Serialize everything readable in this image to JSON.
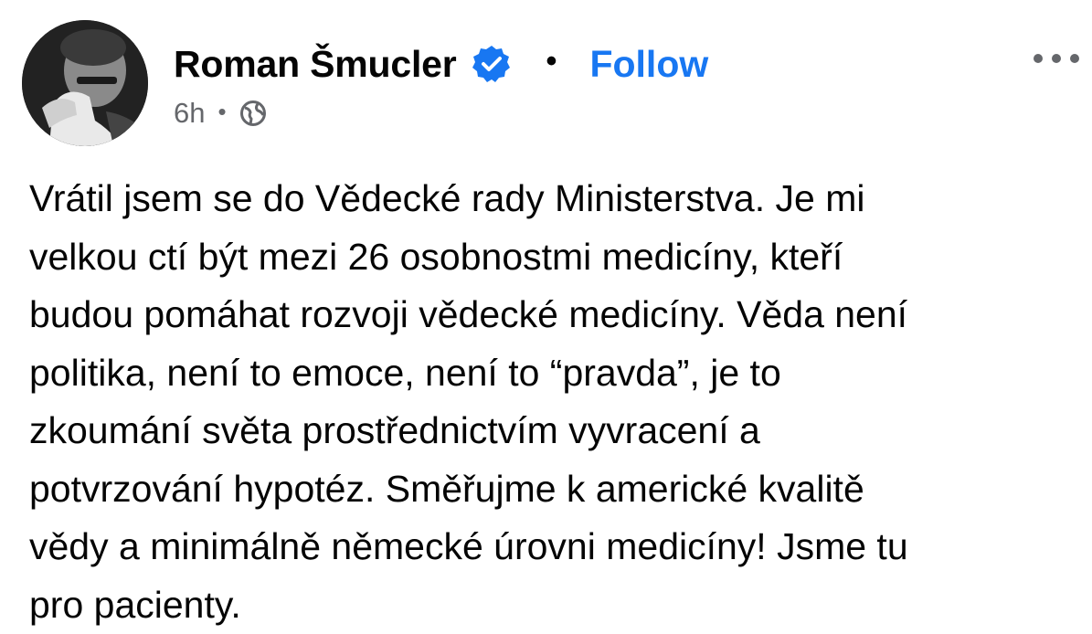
{
  "post": {
    "author": {
      "name": "Roman Šmucler",
      "verified": true,
      "avatar_icon": "profile-photo"
    },
    "follow_label": "Follow",
    "separator": "•",
    "meta": {
      "time": "6h",
      "separator": "•",
      "audience_icon": "globe-icon"
    },
    "more_icon": "more-horizontal-icon",
    "text_lines": [
      "Vrátil jsem se do Vědecké rady Ministerstva. Je mi",
      "velkou ctí být mezi 26 osobnostmi medicíny, kteří",
      "budou pomáhat rozvoji vědecké medicíny. Věda není",
      "politika, není to emoce, není to “pravda”, je to",
      "zkoumání světa prostřednictvím vyvracení a",
      "potvrzování hypotéz. Směřujme k americké kvalitě",
      "vědy a minimálně německé úrovni medicíny! Jsme tu",
      "pro pacienty."
    ]
  },
  "colors": {
    "text": "#050505",
    "secondary": "#65676b",
    "accent": "#1877f2"
  }
}
